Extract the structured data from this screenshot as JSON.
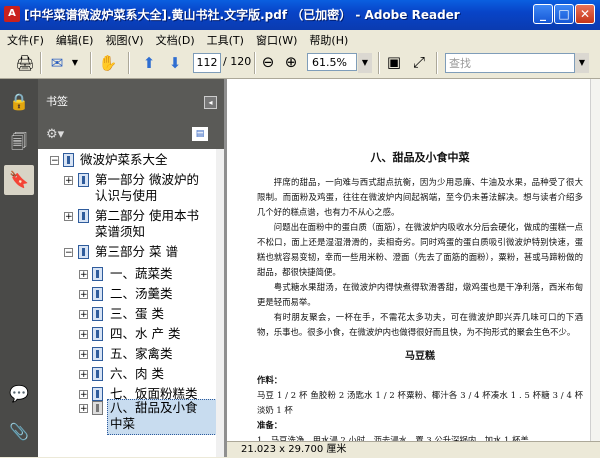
{
  "window": {
    "title": "[中华菜谱微波炉菜系大全].黄山书社.文字版.pdf （已加密） - Adobe Reader",
    "app_icon": "adobe-reader-icon",
    "controls": [
      "minimize-icon",
      "maximize-icon",
      "close-icon"
    ]
  },
  "menu": [
    "文件(F)",
    "编辑(E)",
    "视图(V)",
    "文档(D)",
    "工具(T)",
    "窗口(W)",
    "帮助(H)"
  ],
  "toolbar": {
    "current_page": "112",
    "total_pages": "/ 120",
    "zoom": "61.5%",
    "search_placeholder": "查找"
  },
  "bookmarks": {
    "header": "书签",
    "items": [
      {
        "label": "微波炉菜系大全",
        "level": 0,
        "expanded": true
      },
      {
        "label": "第一部分 微波炉的",
        "label2": "认识与使用",
        "level": 1,
        "expanded": false
      },
      {
        "label": "第二部分 使用本书",
        "label2": "菜谱须知",
        "level": 1,
        "expanded": false
      },
      {
        "label": "第三部分 菜 谱",
        "level": 1,
        "expanded": true
      },
      {
        "label": "一、蔬菜类",
        "level": 2
      },
      {
        "label": "二、汤羹类",
        "level": 2
      },
      {
        "label": "三、蛋 类",
        "level": 2
      },
      {
        "label": "四、水 产 类",
        "level": 2
      },
      {
        "label": "五、家禽类",
        "level": 2
      },
      {
        "label": "六、肉 类",
        "level": 2
      },
      {
        "label": "七、饭面粉糕类",
        "level": 2
      },
      {
        "label": "八、甜品及小食",
        "label2": "中菜",
        "level": 2,
        "selected": true
      }
    ]
  },
  "document": {
    "heading": "八、甜品及小食中菜",
    "paragraphs": [
      "抨席的甜品，一向难与西式甜点抗衡，因为少用忌廉、牛油及水果，品种受了很大限制。而面粉及鸡蛋，往往在微波炉内间起祸端，至今仍未善法解决。想与读者介绍多几个好的糕点谱，也有力不从心之感。",
      "问题出在面粉中的蛋白质（面筋），在微波炉内吸收水分后会硬化，做成的蛋糕一点不松口，面上还是湿湿滑滑的，卖相奇劣。同时鸡蛋的蛋白质吸引微波炉特别快速，蛋糕也就容易变韧，幸而一些用米粉、澄面（先去了面筋的面粉），粟粉，甚或马蹄粉做的甜品，都很快捷简便。",
      "粤式糖水果甜汤，在微波炉内得快煮得软滑香甜，燉鸡蛋也是干净利落，西米布甸更是轻而易举。",
      "有时朋友聚会，一杯在手，不需花太多功夫，可在微波炉即兴弄几味可口的下酒物，乐事也。很多小食，在微波炉内也做得很好而且快，为不拘形式的聚会生色不少。"
    ],
    "recipe_title": "马豆糕",
    "ingredients_label": "作料：",
    "ingredients": "马豆 1 / 2 杯  鱼胶粉 2 汤匙水 1 / 2 杯粟粉、椰汁各 3 / 4 杯凑水 1 . 5 杯糖 3 / 4 杯淡奶 1 杯",
    "prep_label": "准备：",
    "prep": "1、马豆洗净，用水浸 2 小时，沥去浸水，置 3 公升深锅内，加水 1 杯盖"
  },
  "statusbar": {
    "page_size": "21.023 x 29.700 厘米"
  }
}
